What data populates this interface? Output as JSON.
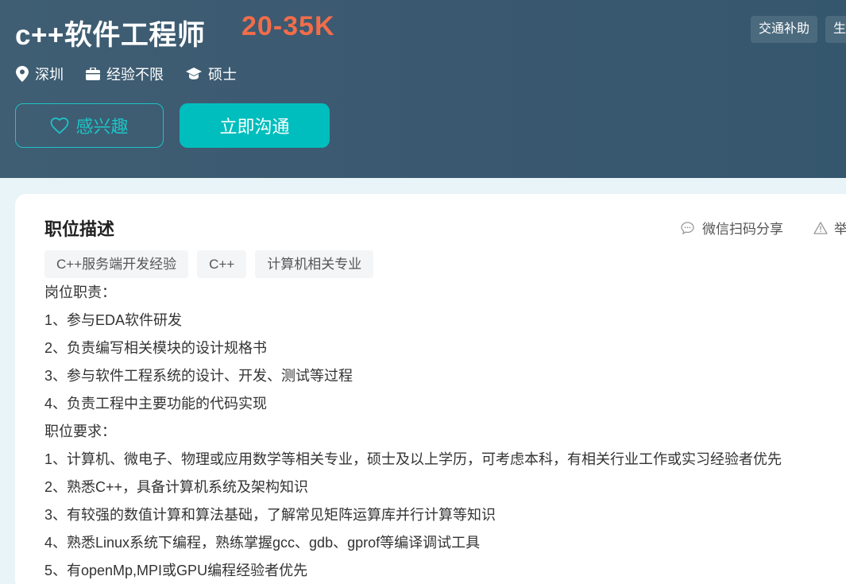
{
  "header": {
    "title": "c++软件工程师",
    "salary": "20-35K",
    "benefits": [
      "交通补助",
      "生"
    ],
    "meta": {
      "location": "深圳",
      "experience": "经验不限",
      "degree": "硕士"
    },
    "interest_label": "感兴趣",
    "chat_label": "立即沟通"
  },
  "card": {
    "section_title": "职位描述",
    "share_label": "微信扫码分享",
    "report_label": "举",
    "tags": [
      "C++服务端开发经验",
      "C++",
      "计算机相关专业"
    ],
    "lines": [
      "岗位职责：",
      "1、参与EDA软件研发",
      "2、负责编写相关模块的设计规格书",
      "3、参与软件工程系统的设计、开发、测试等过程",
      "4、负责工程中主要功能的代码实现",
      "职位要求：",
      "1、计算机、微电子、物理或应用数学等相关专业，硕士及以上学历，可考虑本科，有相关行业工作或实习经验者优先",
      "2、熟悉C++，具备计算机系统及架构知识",
      "3、有较强的数值计算和算法基础，了解常见矩阵运算库并行计算等知识",
      "4、熟悉Linux系统下编程，熟练掌握gcc、gdb、gprof等编译调试工具",
      "5、有openMp,MPI或GPU编程经验者优先"
    ]
  },
  "colors": {
    "header_bg": "#3a5870",
    "salary": "#f26d4a",
    "accent": "#00bebd"
  },
  "icons": {
    "location": "location-pin-icon",
    "experience": "briefcase-icon",
    "degree": "graduation-cap-icon",
    "interest": "heart-icon",
    "share": "chat-bubble-icon",
    "report": "warning-icon"
  }
}
